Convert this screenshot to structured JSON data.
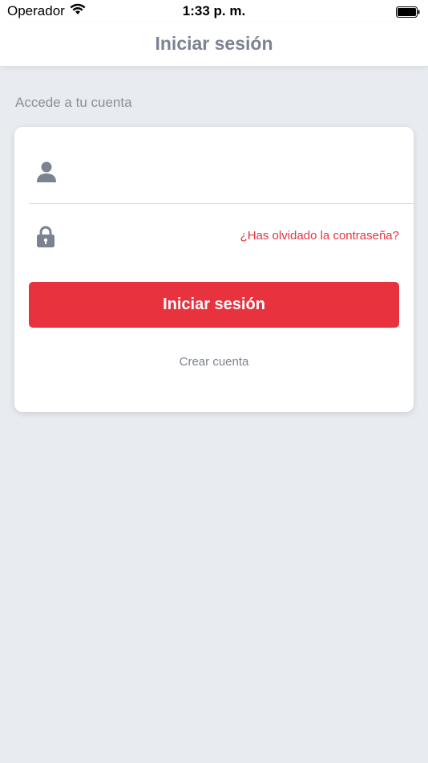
{
  "status_bar": {
    "carrier": "Operador",
    "time": "1:33 p. m."
  },
  "navbar": {
    "title": "Iniciar sesión"
  },
  "login": {
    "subtitle": "Accede a tu cuenta",
    "username_value": "",
    "password_value": "",
    "forgot_password_label": "¿Has olvidado la contraseña?",
    "submit_label": "Iniciar sesión",
    "create_account_label": "Crear cuenta"
  },
  "colors": {
    "accent": "#e8333f",
    "background": "#e8ebef",
    "title_text": "#7c8291",
    "icon": "#7c8291"
  },
  "icons": {
    "wifi": "wifi-icon",
    "battery": "battery-icon",
    "user": "user-icon",
    "lock": "lock-icon"
  }
}
